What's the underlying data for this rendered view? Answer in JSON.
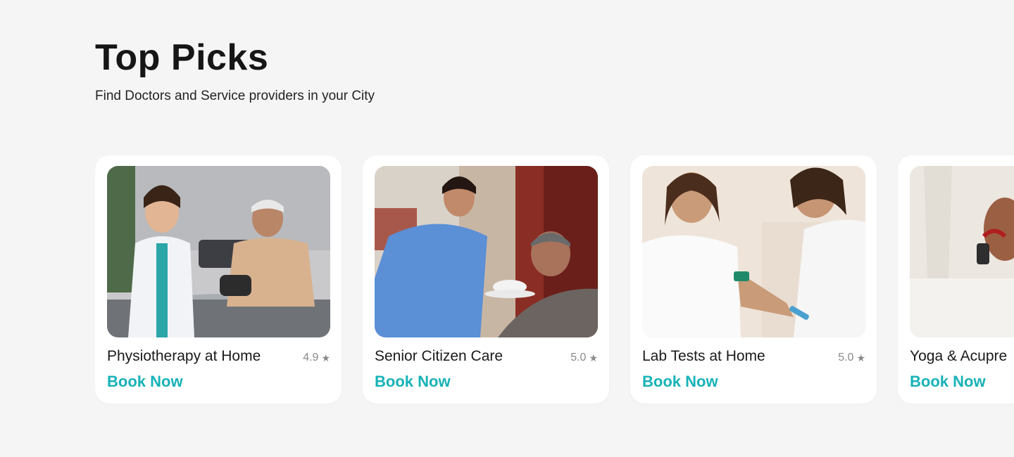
{
  "section": {
    "title": "Top Picks",
    "subtitle": "Find Doctors and Service providers in your City"
  },
  "cards": [
    {
      "name": "Physiotherapy at Home",
      "rating": "4.9",
      "cta": "Book Now",
      "image": "physiotherapist-with-elderly-patient-photo"
    },
    {
      "name": "Senior Citizen Care",
      "rating": "5.0",
      "cta": "Book Now",
      "image": "nurse-feeding-senior-man-photo"
    },
    {
      "name": "Lab Tests at Home",
      "rating": "5.0",
      "cta": "Book Now",
      "image": "blood-sample-collection-photo"
    },
    {
      "name": "Yoga & Acupre",
      "rating": "",
      "cta": "Book Now",
      "image": "acupressure-hands-photo"
    }
  ],
  "icons": {
    "rating": "star-icon"
  },
  "colors": {
    "background": "#f5f5f5",
    "card": "#ffffff",
    "accent": "#17b2b8",
    "rating_text": "#8a8a8a"
  }
}
